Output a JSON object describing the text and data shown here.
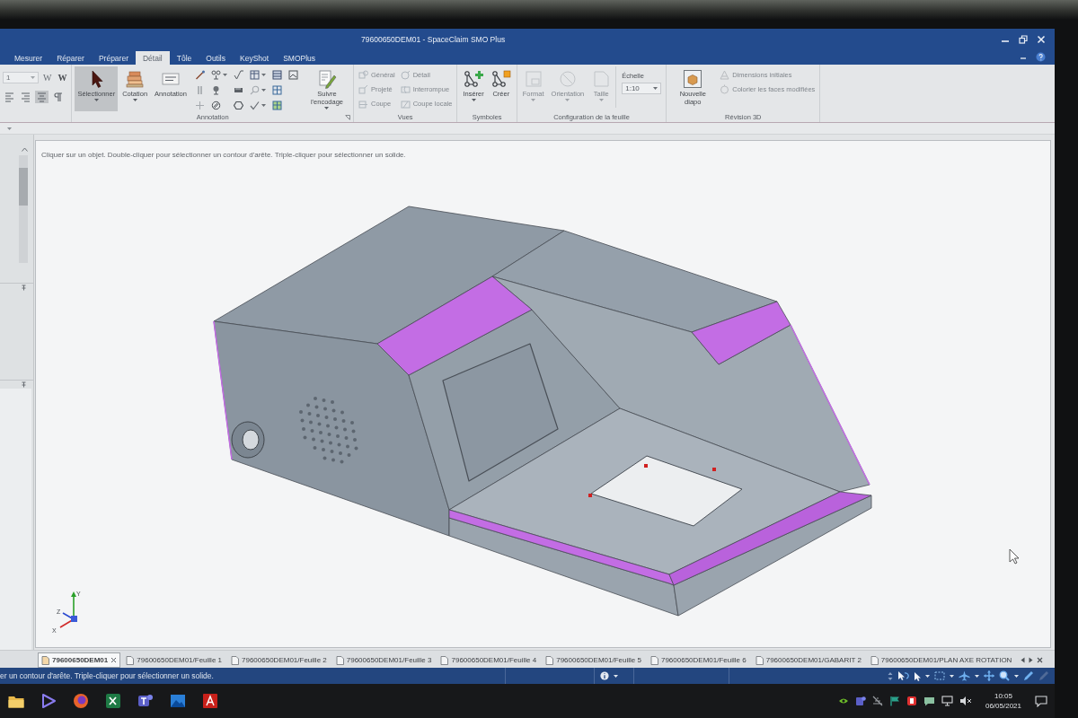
{
  "window": {
    "title": "79600650DEM01 - SpaceClaim SMO Plus"
  },
  "ribbon_tabs": [
    {
      "label": "Mesurer",
      "selected": false
    },
    {
      "label": "Réparer",
      "selected": false
    },
    {
      "label": "Préparer",
      "selected": false
    },
    {
      "label": "Détail",
      "selected": true
    },
    {
      "label": "Tôle",
      "selected": false
    },
    {
      "label": "Outils",
      "selected": false
    },
    {
      "label": "KeyShot",
      "selected": false
    },
    {
      "label": "SMOPlus",
      "selected": false
    }
  ],
  "ribbon": {
    "text_format": {
      "size": "1",
      "style_buttons": [
        "W",
        "W"
      ],
      "align_options": [
        {
          "selected": false
        },
        {
          "selected": false
        },
        {
          "selected": true
        },
        {
          "selected": false
        }
      ]
    },
    "groups": [
      {
        "label": "Annotation",
        "launcher": true,
        "items": [
          {
            "kind": "large",
            "label": "Sélectionner",
            "selected": true,
            "disabled": false,
            "menu": true
          },
          {
            "kind": "large",
            "label": "Cotation",
            "selected": false,
            "disabled": false,
            "menu": true
          },
          {
            "kind": "large",
            "label": "Annotation",
            "selected": false,
            "disabled": false,
            "menu": false
          },
          {
            "kind": "tool_grid"
          },
          {
            "kind": "large",
            "label": "Suivre l'encodage",
            "selected": false,
            "disabled": false,
            "menu": true
          }
        ]
      },
      {
        "label": "Vues",
        "launcher": false,
        "items": [
          {
            "kind": "small_column",
            "entries": [
              {
                "label": "Général",
                "disabled": true
              },
              {
                "label": "Projeté",
                "disabled": true
              },
              {
                "label": "Coupe",
                "disabled": true
              }
            ]
          },
          {
            "kind": "small_column",
            "entries": [
              {
                "label": "Détail",
                "disabled": true
              },
              {
                "label": "Interrompue",
                "disabled": true
              },
              {
                "label": "Coupe locale",
                "disabled": true
              }
            ]
          }
        ]
      },
      {
        "label": "Symboles",
        "launcher": false,
        "items": [
          {
            "kind": "large",
            "label": "Insérer",
            "selected": false,
            "disabled": false,
            "menu": true
          },
          {
            "kind": "large",
            "label": "Créer",
            "selected": false,
            "disabled": false,
            "menu": false
          }
        ]
      },
      {
        "label": "Configuration de la feuille",
        "launcher": false,
        "items": [
          {
            "kind": "large",
            "label": "Format",
            "selected": false,
            "disabled": true,
            "menu": true
          },
          {
            "kind": "large",
            "label": "Orientation",
            "selected": false,
            "disabled": true,
            "menu": true
          },
          {
            "kind": "large",
            "label": "Taille",
            "selected": false,
            "disabled": true,
            "menu": true
          },
          {
            "kind": "scale",
            "label": "Échelle",
            "value": "1:10"
          }
        ]
      },
      {
        "label": "Révision 3D",
        "launcher": false,
        "items": [
          {
            "kind": "large",
            "label": "Nouvelle diapo",
            "selected": false,
            "disabled": false,
            "menu": false
          },
          {
            "kind": "small_column",
            "entries": [
              {
                "label": "Dimensions initiales",
                "disabled": true
              },
              {
                "label": "Colorier les faces modifiées",
                "disabled": true
              }
            ]
          }
        ]
      }
    ]
  },
  "viewport": {
    "hint": "Cliquer sur un objet. Double-cliquer pour sélectionner un contour d'arête. Triple-cliquer pour sélectionner un solide.",
    "axis_labels": {
      "y": "Y",
      "z": "Z",
      "x": "X"
    }
  },
  "sheet_tabs": [
    {
      "label": "79600650DEM01",
      "selected": true
    },
    {
      "label": "79600650DEM01/Feuille 1",
      "selected": false
    },
    {
      "label": "79600650DEM01/Feuille 2",
      "selected": false
    },
    {
      "label": "79600650DEM01/Feuille 3",
      "selected": false
    },
    {
      "label": "79600650DEM01/Feuille 4",
      "selected": false
    },
    {
      "label": "79600650DEM01/Feuille 5",
      "selected": false
    },
    {
      "label": "79600650DEM01/Feuille 6",
      "selected": false
    },
    {
      "label": "79600650DEM01/GABARIT 2",
      "selected": false
    },
    {
      "label": "79600650DEM01/PLAN AXE ROTATION",
      "selected": false
    }
  ],
  "status_bar": {
    "message": "er un contour d'arête. Triple-cliquer pour sélectionner un solide."
  },
  "taskbar": {
    "time": "10:05",
    "date": "06/05/2021"
  }
}
